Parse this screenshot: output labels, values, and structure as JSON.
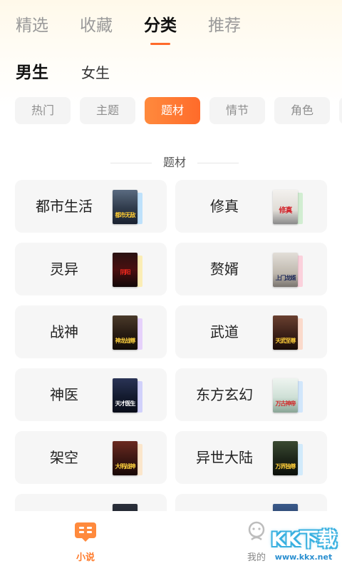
{
  "top_tabs": [
    {
      "label": "精选",
      "active": false
    },
    {
      "label": "收藏",
      "active": false
    },
    {
      "label": "分类",
      "active": true
    },
    {
      "label": "推荐",
      "active": false
    }
  ],
  "gender_tabs": [
    {
      "label": "男生",
      "active": true
    },
    {
      "label": "女生",
      "active": false
    }
  ],
  "filter_chips": [
    {
      "label": "热门",
      "active": false
    },
    {
      "label": "主题",
      "active": false
    },
    {
      "label": "题材",
      "active": true
    },
    {
      "label": "情节",
      "active": false
    },
    {
      "label": "角色",
      "active": false
    }
  ],
  "section_title": "题材",
  "categories": [
    {
      "label": "都市生活",
      "cover_text": "都市无敌",
      "cover_color": "#2f3a4a",
      "cover_text_color": "#ffcc33",
      "shadow_color": "#8fd0ff"
    },
    {
      "label": "修真",
      "cover_text": "修真",
      "cover_color": "#e9e6e2",
      "cover_text_color": "#d3262d",
      "shadow_color": "#b3e6b3"
    },
    {
      "label": "灵异",
      "cover_text": "阴阳",
      "cover_color": "#1a1010",
      "cover_text_color": "#e8281e",
      "shadow_color": "#ffe680"
    },
    {
      "label": "赘婿",
      "cover_text": "上门龙婿",
      "cover_color": "#c9c3bb",
      "cover_text_color": "#1f2a5a",
      "shadow_color": "#ffb3c6"
    },
    {
      "label": "战神",
      "cover_text": "神龙战尊",
      "cover_color": "#261a12",
      "cover_text_color": "#ffd23f",
      "shadow_color": "#d9b3ff"
    },
    {
      "label": "武道",
      "cover_text": "天武至尊",
      "cover_color": "#3b2018",
      "cover_text_color": "#ffcf3a",
      "shadow_color": "#ffc2a8"
    },
    {
      "label": "神医",
      "cover_text": "天才医生",
      "cover_color": "#131a2e",
      "cover_text_color": "#ffffff",
      "shadow_color": "#b3b3ff"
    },
    {
      "label": "东方玄幻",
      "cover_text": "万古神帝",
      "cover_color": "#dbe8e0",
      "cover_text_color": "#d02a2a",
      "shadow_color": "#b3d9ff"
    },
    {
      "label": "架空",
      "cover_text": "大明战神",
      "cover_color": "#3a1612",
      "cover_text_color": "#ffd23f",
      "shadow_color": "#ffd9a8"
    },
    {
      "label": "异世大陆",
      "cover_text": "万界独尊",
      "cover_color": "#1c2418",
      "cover_text_color": "#ffcf3a",
      "shadow_color": "#b3e0ff"
    }
  ],
  "bottom_nav": [
    {
      "label": "小说",
      "icon": "book-icon",
      "active": true
    },
    {
      "label": "我的",
      "icon": "user-icon",
      "active": false
    }
  ],
  "watermark": {
    "title": "KK下载",
    "url": "www.kkx.net"
  },
  "colors": {
    "accent": "#ff6b2a",
    "chip_bg": "#f4f4f4",
    "card_bg": "#f6f6f6"
  }
}
